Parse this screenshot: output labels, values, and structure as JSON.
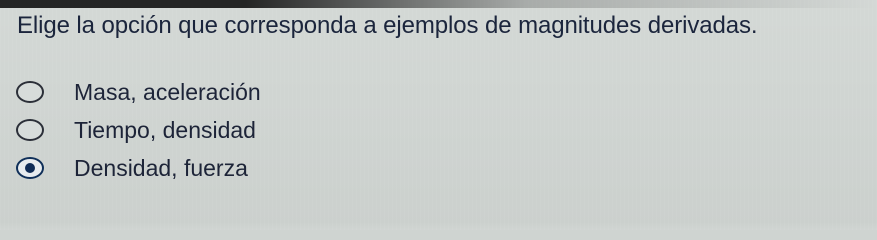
{
  "question": {
    "text": "Elige la opción que corresponda a ejemplos de magnitudes derivadas."
  },
  "options": [
    {
      "label": "Masa, aceleración",
      "selected": false
    },
    {
      "label": "Tiempo, densidad",
      "selected": false
    },
    {
      "label": "Densidad, fuerza",
      "selected": true
    }
  ]
}
